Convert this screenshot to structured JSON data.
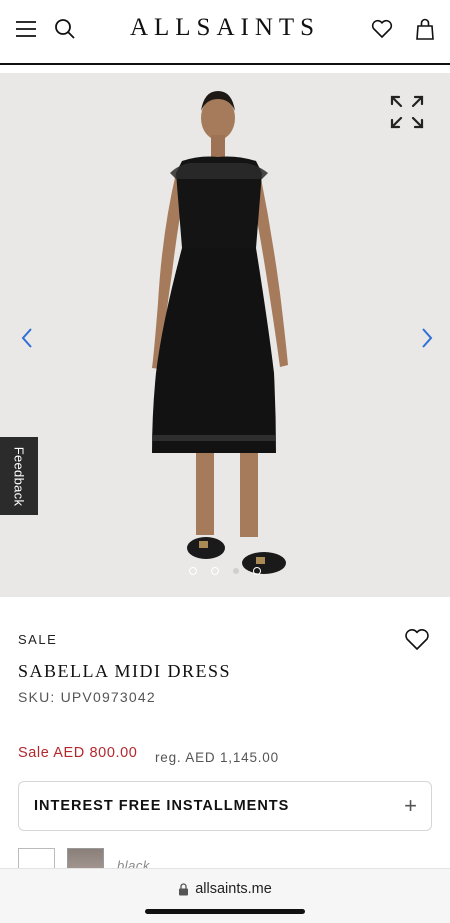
{
  "header": {
    "brand": "ALLSAINTS"
  },
  "gallery": {
    "total_images": 4,
    "active_index": 0
  },
  "feedback_label": "Feedback",
  "product": {
    "badge": "SALE",
    "name": "SABELLA MIDI DRESS",
    "sku": "SKU: UPV0973042",
    "sale_price": "Sale AED 800.00",
    "reg_price": "reg. AED 1,145.00",
    "installments_label": "INTEREST FREE INSTALLMENTS",
    "installments_toggle": "+",
    "color_label": "black"
  },
  "browser": {
    "url": "allsaints.me"
  },
  "colors": {
    "sale_red": "#b3282d",
    "chevron_blue": "#2f6fd8"
  }
}
